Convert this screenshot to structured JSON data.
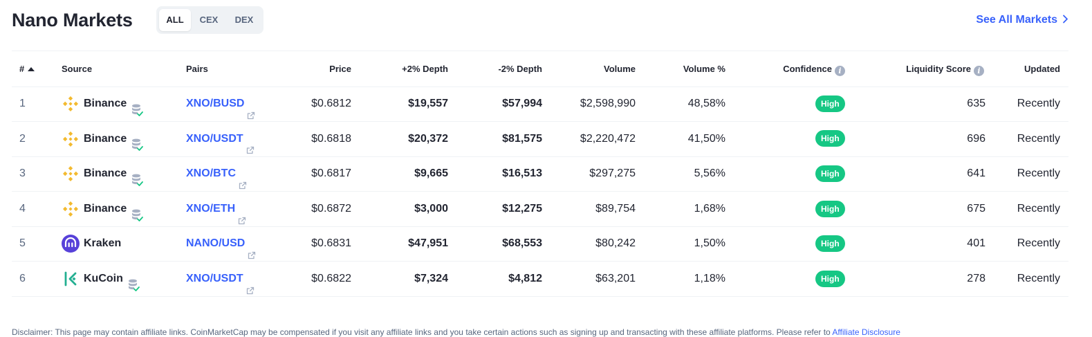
{
  "header": {
    "title": "Nano Markets",
    "tabs": [
      "ALL",
      "CEX",
      "DEX"
    ],
    "active_tab": "ALL",
    "see_all_label": "See All Markets"
  },
  "colors": {
    "accent": "#3861fb",
    "high_badge": "#16c784",
    "binance": "#f3ba2f",
    "kraken": "#5741d9",
    "kucoin": "#23af91"
  },
  "table": {
    "columns": [
      "#",
      "Source",
      "Pairs",
      "Price",
      "+2% Depth",
      "-2% Depth",
      "Volume",
      "Volume %",
      "Confidence",
      "Liquidity Score",
      "Updated"
    ],
    "rows": [
      {
        "rank": "1",
        "source": "Binance",
        "logo": "binance-logo-icon",
        "pair": "XNO/BUSD",
        "price": "$0.6812",
        "depth_plus": "$19,557",
        "depth_minus": "$57,994",
        "volume": "$2,598,990",
        "volume_pct": "48,58%",
        "confidence": "High",
        "liquidity": "635",
        "updated": "Recently"
      },
      {
        "rank": "2",
        "source": "Binance",
        "logo": "binance-logo-icon",
        "pair": "XNO/USDT",
        "price": "$0.6818",
        "depth_plus": "$20,372",
        "depth_minus": "$81,575",
        "volume": "$2,220,472",
        "volume_pct": "41,50%",
        "confidence": "High",
        "liquidity": "696",
        "updated": "Recently"
      },
      {
        "rank": "3",
        "source": "Binance",
        "logo": "binance-logo-icon",
        "pair": "XNO/BTC",
        "price": "$0.6817",
        "depth_plus": "$9,665",
        "depth_minus": "$16,513",
        "volume": "$297,275",
        "volume_pct": "5,56%",
        "confidence": "High",
        "liquidity": "641",
        "updated": "Recently"
      },
      {
        "rank": "4",
        "source": "Binance",
        "logo": "binance-logo-icon",
        "pair": "XNO/ETH",
        "price": "$0.6872",
        "depth_plus": "$3,000",
        "depth_minus": "$12,275",
        "volume": "$89,754",
        "volume_pct": "1,68%",
        "confidence": "High",
        "liquidity": "675",
        "updated": "Recently"
      },
      {
        "rank": "5",
        "source": "Kraken",
        "logo": "kraken-logo-icon",
        "pair": "NANO/USD",
        "price": "$0.6831",
        "depth_plus": "$47,951",
        "depth_minus": "$68,553",
        "volume": "$80,242",
        "volume_pct": "1,50%",
        "confidence": "High",
        "liquidity": "401",
        "updated": "Recently"
      },
      {
        "rank": "6",
        "source": "KuCoin",
        "logo": "kucoin-logo-icon",
        "pair": "XNO/USDT",
        "price": "$0.6822",
        "depth_plus": "$7,324",
        "depth_minus": "$4,812",
        "volume": "$63,201",
        "volume_pct": "1,18%",
        "confidence": "High",
        "liquidity": "278",
        "updated": "Recently"
      }
    ]
  },
  "disclaimer": {
    "text": "Disclaimer: This page may contain affiliate links. CoinMarketCap may be compensated if you visit any affiliate links and you take certain actions such as signing up and transacting with these affiliate platforms. Please refer to ",
    "link": "Affiliate Disclosure"
  }
}
